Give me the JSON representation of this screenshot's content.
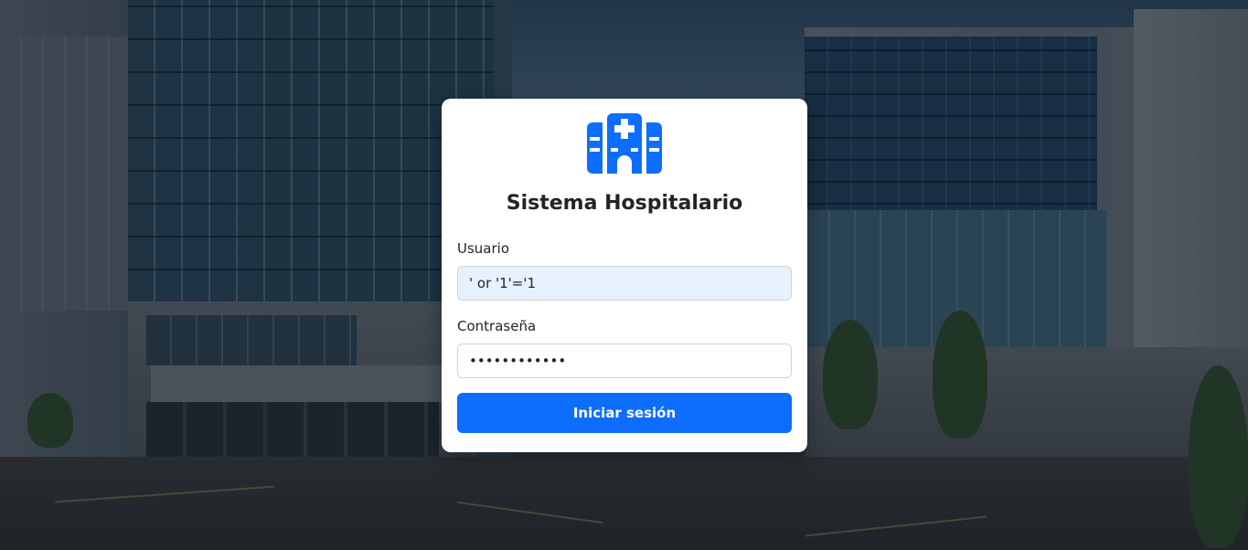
{
  "app": {
    "title": "Sistema Hospitalario",
    "accent_color": "#0d6efd",
    "logo_icon": "hospital-icon"
  },
  "login_form": {
    "username": {
      "label": "Usuario",
      "value": "' or '1'='1"
    },
    "password": {
      "label": "Contraseña",
      "value": "••••••••••••"
    },
    "submit_label": "Iniciar sesión"
  }
}
